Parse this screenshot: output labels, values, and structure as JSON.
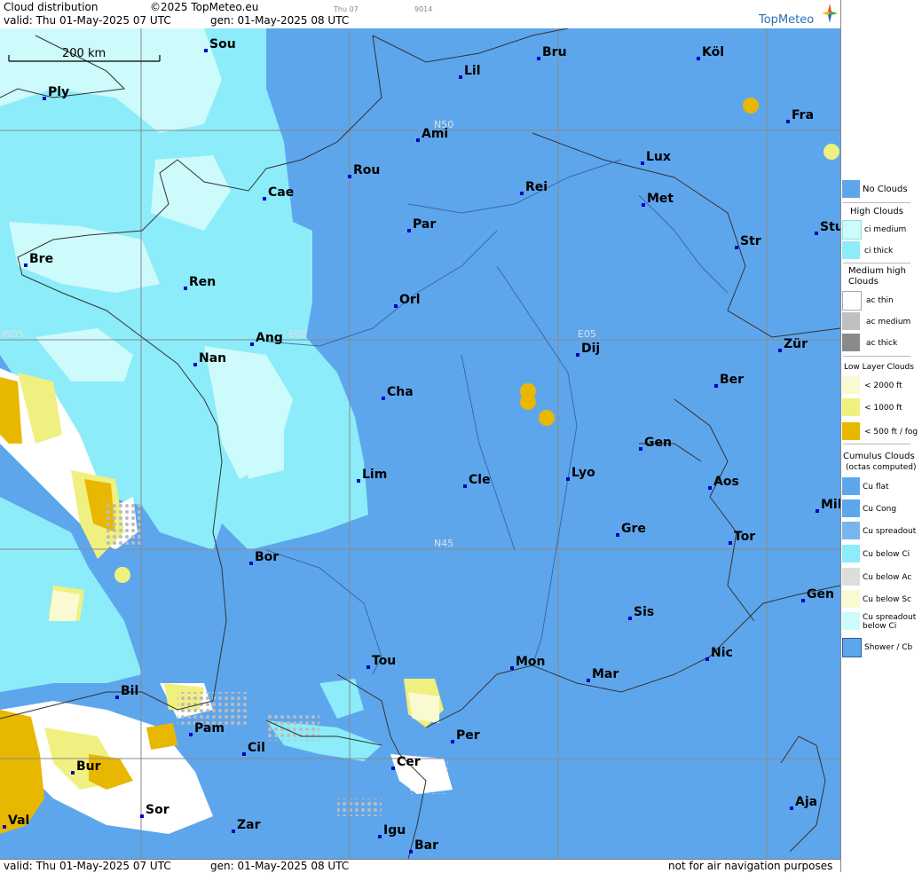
{
  "header": {
    "title": "Cloud distribution",
    "copyright": "©2025 TopMeteo.eu",
    "valid": "valid:  Thu  01-May-2025  07 UTC",
    "gen": "gen: 01-May-2025 08 UTC",
    "small_day": "Thu 07",
    "small_code": "9014",
    "logo": "TopMeteo"
  },
  "footer": {
    "valid": "valid:  Thu  01-May-2025  07 UTC",
    "gen": "gen: 01-May-2025 08 UTC",
    "note": "not for air navigation purposes"
  },
  "map": {
    "scale_label": "200 km",
    "grid_labels": [
      "W05",
      "E00",
      "E05",
      "N50",
      "N45"
    ],
    "cities": [
      "Sou",
      "Bru",
      "Köl",
      "Lil",
      "Ply",
      "Fra",
      "Ami",
      "Lux",
      "Rou",
      "Cae",
      "Rei",
      "Met",
      "Par",
      "Stu",
      "Str",
      "Bre",
      "Ren",
      "Orl",
      "Ang",
      "Zür",
      "Dij",
      "Nan",
      "Ber",
      "Cha",
      "Gen",
      "Lim",
      "Cle",
      "Lyo",
      "Aos",
      "Mil",
      "Gre",
      "Tor",
      "Bor",
      "Sis",
      "Gen",
      "Tou",
      "Mon",
      "Nic",
      "Mar",
      "Bil",
      "Pam",
      "Per",
      "Cil",
      "Bur",
      "Cer",
      "Sor",
      "Val",
      "Zar",
      "Aja",
      "Igu",
      "Bar"
    ]
  },
  "legend": {
    "no_clouds": "No Clouds",
    "high_title": "High Clouds",
    "ci_medium": "ci medium",
    "ci_thick": "ci thick",
    "medium_title": "Medium high Clouds",
    "ac_thin": "ac thin",
    "ac_medium": "ac medium",
    "ac_thick": "ac thick",
    "low_title": "Low Layer Clouds",
    "low_2000": "< 2000 ft",
    "low_1000": "< 1000 ft",
    "low_500": "< 500 ft / fog",
    "cu_title": "Cumulus Clouds",
    "cu_sub": "(octas computed)",
    "cu_flat": "Cu flat",
    "cu_cong": "Cu Cong",
    "cu_spreadout": "Cu spreadout",
    "cu_below_ci": "Cu below Ci",
    "cu_below_ac": "Cu below Ac",
    "cu_below_sc": "Cu below Sc",
    "cu_spread_ci": "Cu spreadout below Ci",
    "shower": "Shower / Cb"
  },
  "colors": {
    "no_clouds": "#5ea6ec",
    "ci_medium": "#cdfafa",
    "ci_thick": "#8cecfa",
    "low_2000": "#fafad2",
    "low_1000": "#f0f080",
    "low_500": "#e8b800",
    "ac_thin": "#ffffff",
    "ac_medium": "#c0c0c0",
    "ac_thick": "#8a8a8a"
  }
}
